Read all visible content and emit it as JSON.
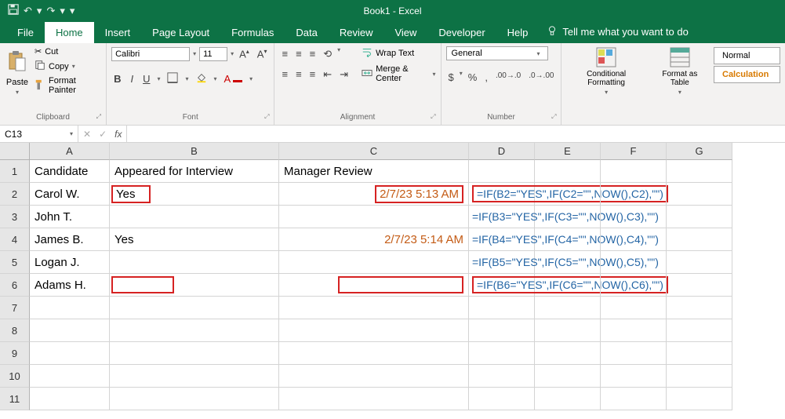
{
  "title": "Book1 - Excel",
  "qat": {
    "undo": "↶",
    "redo": "↷"
  },
  "tabs": [
    "File",
    "Home",
    "Insert",
    "Page Layout",
    "Formulas",
    "Data",
    "Review",
    "View",
    "Developer",
    "Help"
  ],
  "tell_me": "Tell me what you want to do",
  "clipboard": {
    "paste": "Paste",
    "cut": "Cut",
    "copy": "Copy",
    "format_painter": "Format Painter",
    "label": "Clipboard"
  },
  "font": {
    "name": "Calibri",
    "size": "11",
    "label": "Font"
  },
  "alignment": {
    "wrap": "Wrap Text",
    "merge": "Merge & Center",
    "label": "Alignment"
  },
  "number": {
    "format": "General",
    "label": "Number"
  },
  "styles": {
    "cond": "Conditional Formatting",
    "table": "Format as Table",
    "normal": "Normal",
    "calc": "Calculation"
  },
  "name_box": "C13",
  "fx": "fx",
  "columns": [
    "A",
    "B",
    "C",
    "D",
    "E",
    "F",
    "G"
  ],
  "row_numbers": [
    "1",
    "2",
    "3",
    "4",
    "5",
    "6",
    "7",
    "8",
    "9",
    "10",
    "11"
  ],
  "sheet": {
    "headers": {
      "a": "Candidate",
      "b": "Appeared for Interview",
      "c": "Manager Review"
    },
    "rows": [
      {
        "a": "Carol W.",
        "b": "Yes",
        "c": "2/7/23 5:13 AM",
        "d": "=IF(B2=\"YES\",IF(C2=\"\",NOW(),C2),\"\")"
      },
      {
        "a": "John T.",
        "b": "",
        "c": "",
        "d": "=IF(B3=\"YES\",IF(C3=\"\",NOW(),C3),\"\")"
      },
      {
        "a": "James B.",
        "b": "Yes",
        "c": "2/7/23 5:14 AM",
        "d": "=IF(B4=\"YES\",IF(C4=\"\",NOW(),C4),\"\")"
      },
      {
        "a": "Logan J.",
        "b": "",
        "c": "",
        "d": "=IF(B5=\"YES\",IF(C5=\"\",NOW(),C5),\"\")"
      },
      {
        "a": "Adams H.",
        "b": "",
        "c": "",
        "d": "=IF(B6=\"YES\",IF(C6=\"\",NOW(),C6),\"\")"
      }
    ]
  },
  "annotations": {
    "highlighted_cells": [
      "B2",
      "C2",
      "D2",
      "B6",
      "C6",
      "D6"
    ],
    "colors": {
      "formula_text": "#2465a5",
      "date_text": "#c45c16",
      "highlight_border": "#d62222",
      "excel_green": "#0d7245"
    }
  }
}
